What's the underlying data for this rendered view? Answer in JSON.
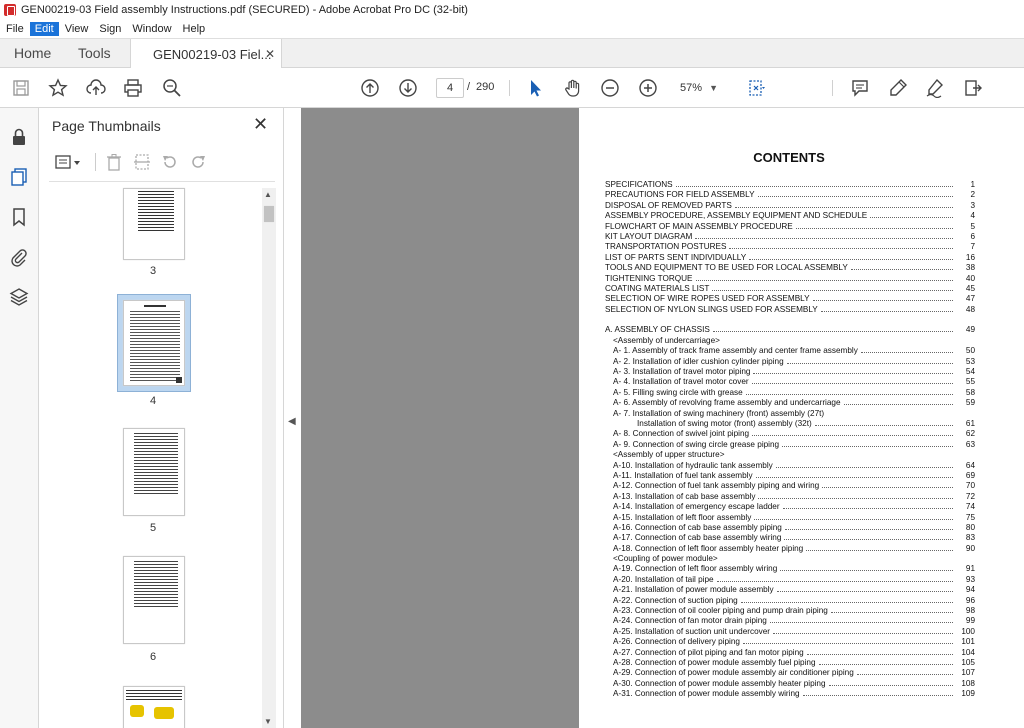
{
  "window": {
    "title": "GEN00219-03 Field assembly Instructions.pdf (SECURED) - Adobe Acrobat Pro DC (32-bit)"
  },
  "menu": [
    "File",
    "Edit",
    "View",
    "Sign",
    "Window",
    "Help"
  ],
  "tabs": {
    "home": "Home",
    "tools": "Tools",
    "document": "GEN00219-03 Fiel...",
    "close": "✕"
  },
  "toolbar": {
    "page_current": "4",
    "page_separator": "/",
    "page_total": "290",
    "zoom": "57%"
  },
  "thumbnails_panel": {
    "title": "Page Thumbnails",
    "close": "✕",
    "pages": [
      {
        "label": "3",
        "selected": false
      },
      {
        "label": "4",
        "selected": true
      },
      {
        "label": "5",
        "selected": false
      },
      {
        "label": "6",
        "selected": false
      }
    ]
  },
  "document": {
    "title": "CONTENTS",
    "toc": [
      {
        "text": "SPECIFICATIONS",
        "page": "1"
      },
      {
        "text": "PRECAUTIONS FOR FIELD ASSEMBLY",
        "page": "2"
      },
      {
        "text": "DISPOSAL OF REMOVED PARTS",
        "page": "3"
      },
      {
        "text": "ASSEMBLY PROCEDURE, ASSEMBLY EQUIPMENT AND SCHEDULE",
        "page": "4"
      },
      {
        "text": "FLOWCHART OF MAIN ASSEMBLY PROCEDURE",
        "page": "5"
      },
      {
        "text": "KIT LAYOUT DIAGRAM",
        "page": "6"
      },
      {
        "text": "TRANSPORTATION POSTURES",
        "page": "7"
      },
      {
        "text": "LIST OF PARTS SENT INDIVIDUALLY",
        "page": "16"
      },
      {
        "text": "TOOLS AND EQUIPMENT TO BE USED FOR LOCAL ASSEMBLY",
        "page": "38"
      },
      {
        "text": "TIGHTENING TORQUE",
        "page": "40"
      },
      {
        "text": "COATING MATERIALS LIST",
        "page": "45"
      },
      {
        "text": "SELECTION OF WIRE ROPES USED FOR ASSEMBLY",
        "page": "47"
      },
      {
        "text": "SELECTION OF NYLON SLINGS USED FOR ASSEMBLY",
        "page": "48"
      }
    ],
    "chassis_heading": {
      "text": "A. ASSEMBLY OF CHASSIS",
      "page": "49"
    },
    "chassis": [
      {
        "text": "<Assembly of undercarriage>",
        "page": "",
        "kind": "heading"
      },
      {
        "text": "A- 1. Assembly of track frame assembly and center frame assembly",
        "page": "50"
      },
      {
        "text": "A- 2. Installation of idler cushion cylinder piping",
        "page": "53"
      },
      {
        "text": "A- 3. Installation of travel motor piping",
        "page": "54"
      },
      {
        "text": "A- 4. Installation of travel motor cover",
        "page": "55"
      },
      {
        "text": "A- 5. Filling swing circle with grease",
        "page": "58"
      },
      {
        "text": "A- 6. Assembly of revolving frame assembly and undercarriage",
        "page": "59"
      },
      {
        "text": "A- 7. Installation of swing machinery (front) assembly (27t)",
        "page": "",
        "kind": "nodots"
      },
      {
        "text": "Installation of swing motor (front) assembly (32t)",
        "page": "61",
        "kind": "sub"
      },
      {
        "text": "A- 8. Connection of swivel joint piping",
        "page": "62"
      },
      {
        "text": "A- 9. Connection of swing circle grease piping",
        "page": "63"
      },
      {
        "text": "<Assembly of upper structure>",
        "page": "",
        "kind": "heading"
      },
      {
        "text": "A-10. Installation of hydraulic tank assembly",
        "page": "64"
      },
      {
        "text": "A-11. Installation of fuel tank assembly",
        "page": "69"
      },
      {
        "text": "A-12. Connection of fuel tank assembly piping and wiring",
        "page": "70"
      },
      {
        "text": "A-13. Installation of cab base assembly",
        "page": "72"
      },
      {
        "text": "A-14. Installation of emergency escape ladder",
        "page": "74"
      },
      {
        "text": "A-15. Installation of left floor assembly",
        "page": "75"
      },
      {
        "text": "A-16. Connection of cab base assembly piping",
        "page": "80"
      },
      {
        "text": "A-17. Connection of cab base assembly wiring",
        "page": "83"
      },
      {
        "text": "A-18. Connection of left floor assembly heater piping",
        "page": "90"
      },
      {
        "text": "<Coupling of power module>",
        "page": "",
        "kind": "heading"
      },
      {
        "text": "A-19. Connection of left floor assembly wiring",
        "page": "91"
      },
      {
        "text": "A-20. Installation of tail pipe",
        "page": "93"
      },
      {
        "text": "A-21. Installation of power module assembly",
        "page": "94"
      },
      {
        "text": "A-22. Connection of suction piping",
        "page": "96"
      },
      {
        "text": "A-23. Connection of oil cooler piping and pump drain piping",
        "page": "98"
      },
      {
        "text": "A-24. Connection of fan motor drain piping",
        "page": "99"
      },
      {
        "text": "A-25. Installation of suction unit undercover",
        "page": "100"
      },
      {
        "text": "A-26. Connection of delivery piping",
        "page": "101"
      },
      {
        "text": "A-27. Connection of pilot piping and fan motor piping",
        "page": "104"
      },
      {
        "text": "A-28. Connection of power module assembly fuel piping",
        "page": "105"
      },
      {
        "text": "A-29. Connection of power module assembly air conditioner piping",
        "page": "107"
      },
      {
        "text": "A-30. Connection of power module assembly heater piping",
        "page": "108"
      },
      {
        "text": "A-31. Connection of power module assembly wiring",
        "page": "109"
      }
    ]
  },
  "icons": {
    "toolbar": [
      "save-icon",
      "bookmark-star-icon",
      "cloud-upload-icon",
      "print-icon",
      "zoom-search-icon",
      "page-up-icon",
      "page-down-icon",
      "select-arrow-icon",
      "hand-icon",
      "zoom-out-icon",
      "zoom-in-icon",
      "fit-page-icon",
      "comment-icon",
      "highlight-pen-icon",
      "sign-icon",
      "share-icon"
    ],
    "rail": [
      "lock-icon",
      "pages-icon",
      "bookmark-icon",
      "attachment-icon",
      "layers-icon"
    ]
  },
  "colors": {
    "accent": "#1a73d9",
    "doc_bg": "#8c8c8c",
    "selected_thumb": "#bcd6f0"
  }
}
